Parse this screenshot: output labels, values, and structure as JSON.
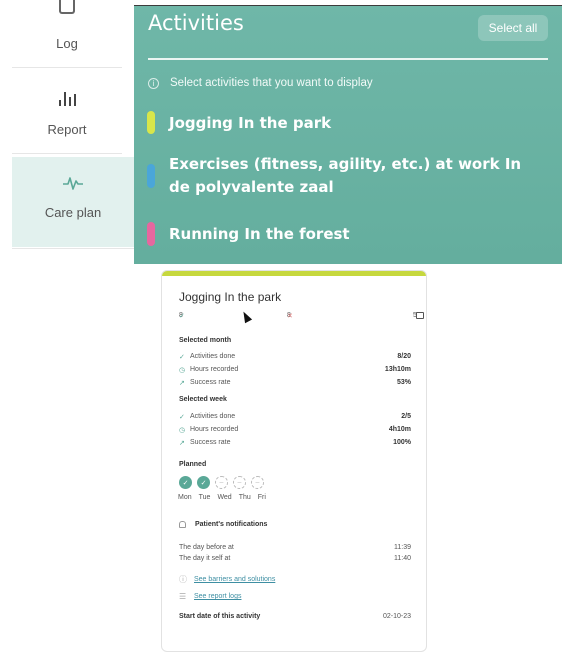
{
  "sidebar": {
    "items": [
      {
        "label": "Log",
        "icon": "log-icon"
      },
      {
        "label": "Report",
        "icon": "bar-chart-icon"
      },
      {
        "label": "Care plan",
        "icon": "pulse-icon"
      }
    ],
    "active_bg": "#e2f1ee",
    "icon_color": "#5aa897"
  },
  "panel": {
    "title": "Activities",
    "select_all_label": "Select all",
    "info_text": "Select activities that you want to display",
    "bg_color": "#6fb7a8",
    "activities": [
      {
        "label": "Jogging In the park",
        "color": "#d8e64a"
      },
      {
        "label": "Exercises (fitness, agility, etc.) at work In de polyvalente zaal",
        "color": "#4aa6d9"
      },
      {
        "label": "Running In the forest",
        "color": "#e6679f"
      }
    ]
  },
  "card": {
    "accent_color": "#c6d83e",
    "title": "Jogging In the park",
    "stats": {
      "done": "8",
      "missed": "8",
      "planned": "5"
    },
    "selected_month": {
      "heading": "Selected month",
      "rows": [
        {
          "label": "Activities done",
          "value": "8/20"
        },
        {
          "label": "Hours recorded",
          "value": "13h10m"
        },
        {
          "label": "Success rate",
          "value": "53%"
        }
      ]
    },
    "selected_week": {
      "heading": "Selected week",
      "rows": [
        {
          "label": "Activities done",
          "value": "2/5"
        },
        {
          "label": "Hours recorded",
          "value": "4h10m"
        },
        {
          "label": "Success rate",
          "value": "100%"
        }
      ]
    },
    "planned": {
      "heading": "Planned",
      "days": [
        {
          "label": "Mon",
          "done": true
        },
        {
          "label": "Tue",
          "done": true
        },
        {
          "label": "Wed",
          "done": false
        },
        {
          "label": "Thu",
          "done": false
        },
        {
          "label": "Fri",
          "done": false
        }
      ]
    },
    "notifications": {
      "heading": "Patient's notifications",
      "rows": [
        {
          "label": "The day before at",
          "value": "11:39"
        },
        {
          "label": "The day it self at",
          "value": "11:40"
        }
      ]
    },
    "links": {
      "barriers": "See barriers and solutions",
      "report_logs": "See report logs"
    },
    "start_date": {
      "label": "Start date of this activity",
      "value": "02-10-23"
    }
  }
}
